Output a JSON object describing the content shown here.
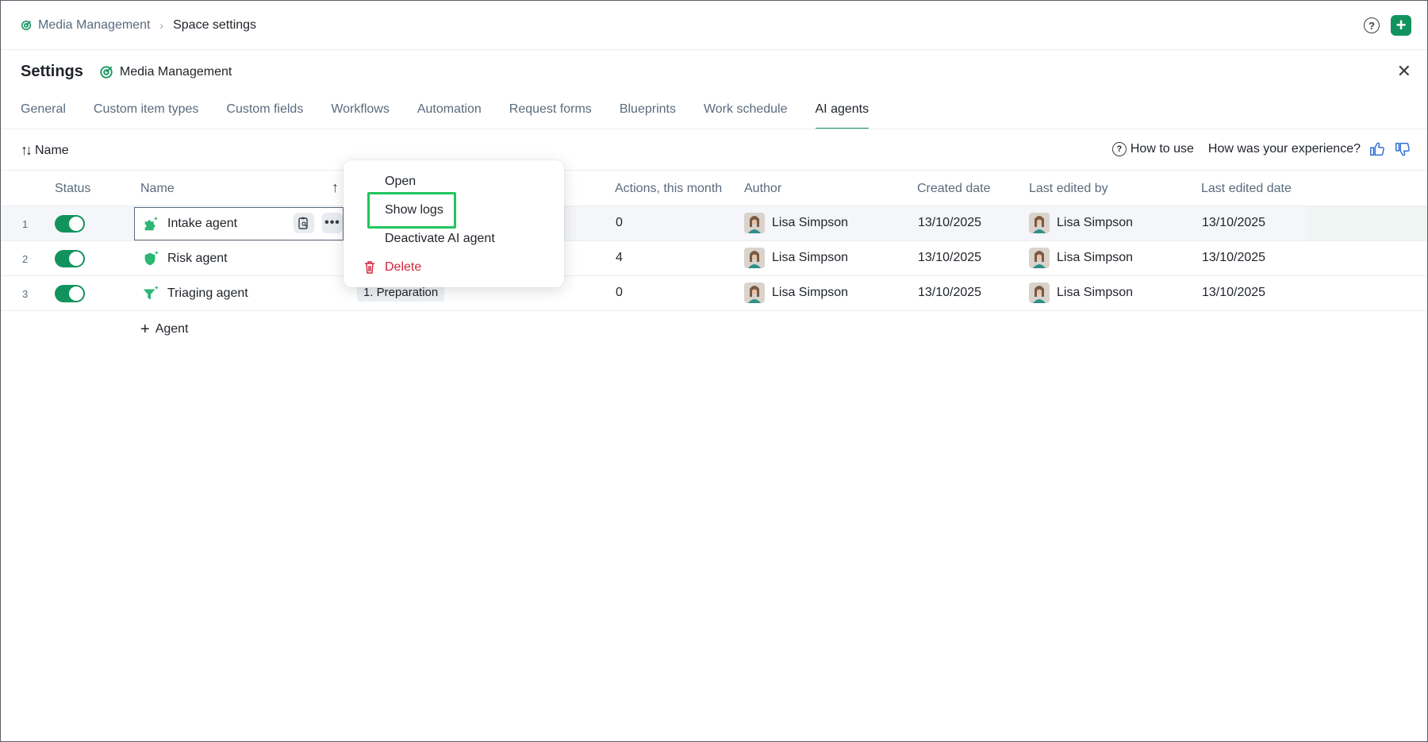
{
  "breadcrumb": {
    "space": "Media Management",
    "current": "Space settings"
  },
  "header": {
    "title": "Settings",
    "space_name": "Media Management"
  },
  "tabs": [
    {
      "label": "General"
    },
    {
      "label": "Custom item types"
    },
    {
      "label": "Custom fields"
    },
    {
      "label": "Workflows"
    },
    {
      "label": "Automation"
    },
    {
      "label": "Request forms"
    },
    {
      "label": "Blueprints"
    },
    {
      "label": "Work schedule"
    },
    {
      "label": "AI agents",
      "active": true
    }
  ],
  "toolbar": {
    "sort_label": "Name",
    "how_to_use": "How to use",
    "feedback": "How was your experience?"
  },
  "table": {
    "columns": {
      "status": "Status",
      "name": "Name",
      "actions": "Actions, this month",
      "author": "Author",
      "created": "Created date",
      "edited_by": "Last edited by",
      "edited_date": "Last edited date"
    },
    "rows": [
      {
        "index": "1",
        "enabled": true,
        "name": "Intake agent",
        "stage": "",
        "actions": "0",
        "author": "Lisa Simpson",
        "created": "13/10/2025",
        "edited_by": "Lisa Simpson",
        "edited_date": "13/10/2025"
      },
      {
        "index": "2",
        "enabled": true,
        "name": "Risk agent",
        "stage": "",
        "actions": "4",
        "author": "Lisa Simpson",
        "created": "13/10/2025",
        "edited_by": "Lisa Simpson",
        "edited_date": "13/10/2025"
      },
      {
        "index": "3",
        "enabled": true,
        "name": "Triaging agent",
        "stage": "1. Preparation",
        "actions": "0",
        "author": "Lisa Simpson",
        "created": "13/10/2025",
        "edited_by": "Lisa Simpson",
        "edited_date": "13/10/2025"
      }
    ],
    "add_label": "Agent"
  },
  "context_menu": {
    "items": [
      {
        "label": "Open"
      },
      {
        "label": "Show logs",
        "highlighted": true
      },
      {
        "label": "Deactivate AI agent"
      },
      {
        "label": "Delete",
        "danger": true
      }
    ]
  },
  "colors": {
    "accent": "#12935e",
    "danger": "#d0243a",
    "highlight": "#22c55e"
  }
}
